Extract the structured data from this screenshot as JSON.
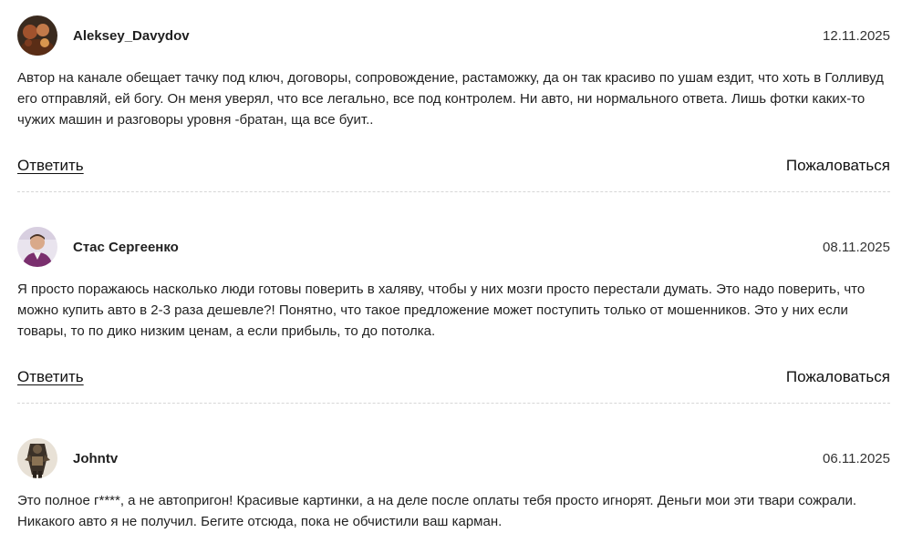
{
  "actions": {
    "reply_label": "Ответить",
    "report_label": "Пожаловаться"
  },
  "comments": [
    {
      "author": "Aleksey_Davydov",
      "date": "12.11.2025",
      "avatar_icon": "user-avatar-icon",
      "text": "Автор на канале обещает тачку под ключ, договоры, сопровождение, растаможку, да он так красиво по ушам ездит, что хоть в Голливуд его отправляй, ей богу. Он меня уверял, что все легально, все под контролем. Ни авто, ни нормального ответа. Лишь фотки каких-то чужих машин и разговоры уровня -братан, ща все буит.."
    },
    {
      "author": "Стас Сергеенко",
      "date": "08.11.2025",
      "avatar_icon": "user-avatar-icon",
      "text": "Я просто поражаюсь насколько люди готовы поверить в халяву, чтобы у них мозги просто перестали думать. Это надо поверить, что можно купить авто в 2-3 раза дешевле?! Понятно, что такое предложение может поступить только от мошенников. Это у них если товары, то по дико низким ценам, а если прибыль, то до потолка."
    },
    {
      "author": "Johntv",
      "date": "06.11.2025",
      "avatar_icon": "user-avatar-icon",
      "text": "Это полное г****, а не автопригон! Красивые картинки, а на деле после оплаты тебя просто игнорят. Деньги мои эти твари сожрали. Никакого авто я не получил. Бегите отсюда, пока не обчистили ваш карман."
    }
  ]
}
